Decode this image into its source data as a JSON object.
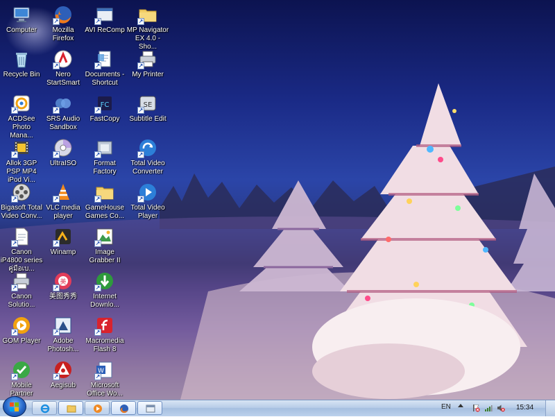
{
  "colors": {
    "taskbar": "#b8cde8",
    "wallpaper_sky": "#1a2a86",
    "label_text": "#ffffff"
  },
  "desktop": {
    "icons": [
      {
        "label": "Computer",
        "icon": "computer-icon",
        "col": 0,
        "row": 0
      },
      {
        "label": "Recycle Bin",
        "icon": "recycle-bin-icon",
        "col": 0,
        "row": 1
      },
      {
        "label": "ACDSee Photo Mana...",
        "icon": "acdsee-icon",
        "col": 0,
        "row": 2
      },
      {
        "label": "Allok 3GP PSP MP4 iPod Vi...",
        "icon": "film-icon",
        "col": 0,
        "row": 3
      },
      {
        "label": "Bigasoft Total Video Conv...",
        "icon": "film-reel-icon",
        "col": 0,
        "row": 4
      },
      {
        "label": "Canon iP4800 series คู่มือเบ...",
        "icon": "document-icon",
        "col": 0,
        "row": 5
      },
      {
        "label": "Canon Solutio...",
        "icon": "printer-icon",
        "col": 0,
        "row": 6
      },
      {
        "label": "GOM Player",
        "icon": "gom-player-icon",
        "col": 0,
        "row": 7
      },
      {
        "label": "Mobile Partner",
        "icon": "mobile-partner-icon",
        "col": 0,
        "row": 8
      },
      {
        "label": "Mozilla Firefox",
        "icon": "firefox-icon",
        "col": 1,
        "row": 0
      },
      {
        "label": "Nero StartSmart",
        "icon": "nero-icon",
        "col": 1,
        "row": 1
      },
      {
        "label": "SRS Audio Sandbox",
        "icon": "audio-icon",
        "col": 1,
        "row": 2
      },
      {
        "label": "UltraISO",
        "icon": "disc-icon",
        "col": 1,
        "row": 3
      },
      {
        "label": "VLC media player",
        "icon": "vlc-cone-icon",
        "col": 1,
        "row": 4
      },
      {
        "label": "Winamp",
        "icon": "winamp-icon",
        "col": 1,
        "row": 5
      },
      {
        "label": "美图秀秀",
        "icon": "meitu-icon",
        "col": 1,
        "row": 6
      },
      {
        "label": "Adobe Photosh...",
        "icon": "photoshop-icon",
        "col": 1,
        "row": 7
      },
      {
        "label": "Aegisub",
        "icon": "aegisub-icon",
        "col": 1,
        "row": 8
      },
      {
        "label": "AVI ReComp",
        "icon": "program-icon",
        "col": 2,
        "row": 0
      },
      {
        "label": "Documents - Shortcut",
        "icon": "documents-icon",
        "col": 2,
        "row": 1
      },
      {
        "label": "FastCopy",
        "icon": "fastcopy-icon",
        "col": 2,
        "row": 2
      },
      {
        "label": "Format Factory",
        "icon": "format-factory-icon",
        "col": 2,
        "row": 3
      },
      {
        "label": "GameHouse Games Co...",
        "icon": "folder-icon",
        "col": 2,
        "row": 4
      },
      {
        "label": "Image Grabber II",
        "icon": "image-grabber-icon",
        "col": 2,
        "row": 5
      },
      {
        "label": "Internet Downlo...",
        "icon": "download-icon",
        "col": 2,
        "row": 6
      },
      {
        "label": "Macromedia Flash 8",
        "icon": "flash-icon",
        "col": 2,
        "row": 7
      },
      {
        "label": "Microsoft Office Wo...",
        "icon": "word-icon",
        "col": 2,
        "row": 8
      },
      {
        "label": "MP Navigator EX 4.0 - Sho...",
        "icon": "folder-icon",
        "col": 3,
        "row": 0
      },
      {
        "label": "My Printer",
        "icon": "printer-icon",
        "col": 3,
        "row": 1
      },
      {
        "label": "Subtitle Edit",
        "icon": "subtitle-edit-icon",
        "col": 3,
        "row": 2
      },
      {
        "label": "Total Video Converter",
        "icon": "video-converter-icon",
        "col": 3,
        "row": 3
      },
      {
        "label": "Total Video Player",
        "icon": "video-player-icon",
        "col": 3,
        "row": 4
      }
    ]
  },
  "taskbar": {
    "start_icon": "windows-logo-icon",
    "pinned": [
      {
        "icon": "internet-explorer-icon",
        "active": false
      },
      {
        "icon": "explorer-folder-icon",
        "active": true
      },
      {
        "icon": "media-player-icon",
        "active": false
      },
      {
        "icon": "firefox-icon",
        "active": true
      },
      {
        "icon": "program-window-icon",
        "active": true
      }
    ],
    "language": "EN",
    "clock": "15:34"
  }
}
